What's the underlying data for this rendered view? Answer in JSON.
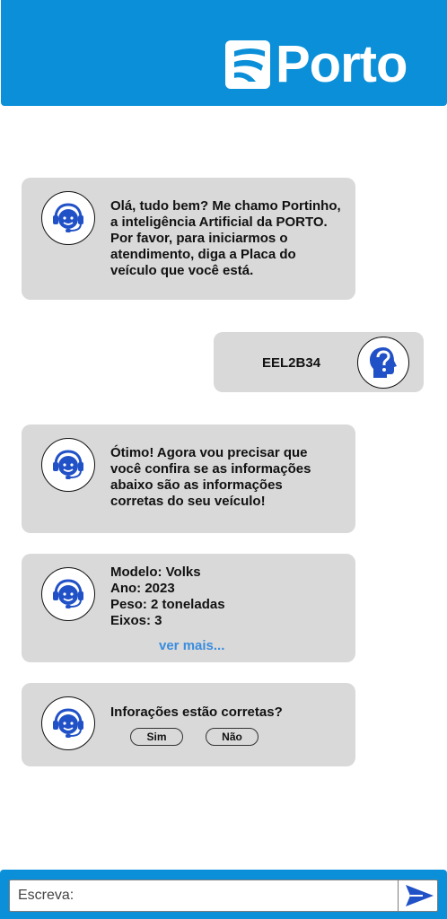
{
  "header": {
    "logo_text": "Porto"
  },
  "colors": {
    "brand_blue": "#0a8fd8",
    "bubble_gray": "#d9d9d9",
    "agent_icon_blue": "#2151c7",
    "link_blue": "#3a8dde"
  },
  "messages": [
    {
      "sender": "bot",
      "icon": "support-agent-icon",
      "text": "Olá, tudo bem? Me chamo Portinho, a inteligência Artificial da PORTO. Por favor, para iniciarmos o atendimento, diga a Placa do veículo que você está."
    },
    {
      "sender": "user",
      "icon": "question-head-icon",
      "text": "EEL2B34"
    },
    {
      "sender": "bot",
      "icon": "support-agent-icon",
      "text_before": "Ótimo! Agora vou precisar que você confira se as informações abaixo são as ",
      "text_bold": "informações corretas",
      "text_after": " do seu veículo!"
    },
    {
      "sender": "bot",
      "icon": "support-agent-icon",
      "lines": [
        "Modelo: Volks",
        "Ano: 2023",
        "Peso: 2 toneladas",
        "Eixos: 3"
      ],
      "link": "ver mais..."
    },
    {
      "sender": "bot",
      "icon": "support-agent-icon",
      "text": "Inforações estão corretas?",
      "options": [
        "Sim",
        "Não"
      ]
    }
  ],
  "composer": {
    "placeholder": "Escreva:",
    "send_icon": "send-arrow-icon"
  }
}
